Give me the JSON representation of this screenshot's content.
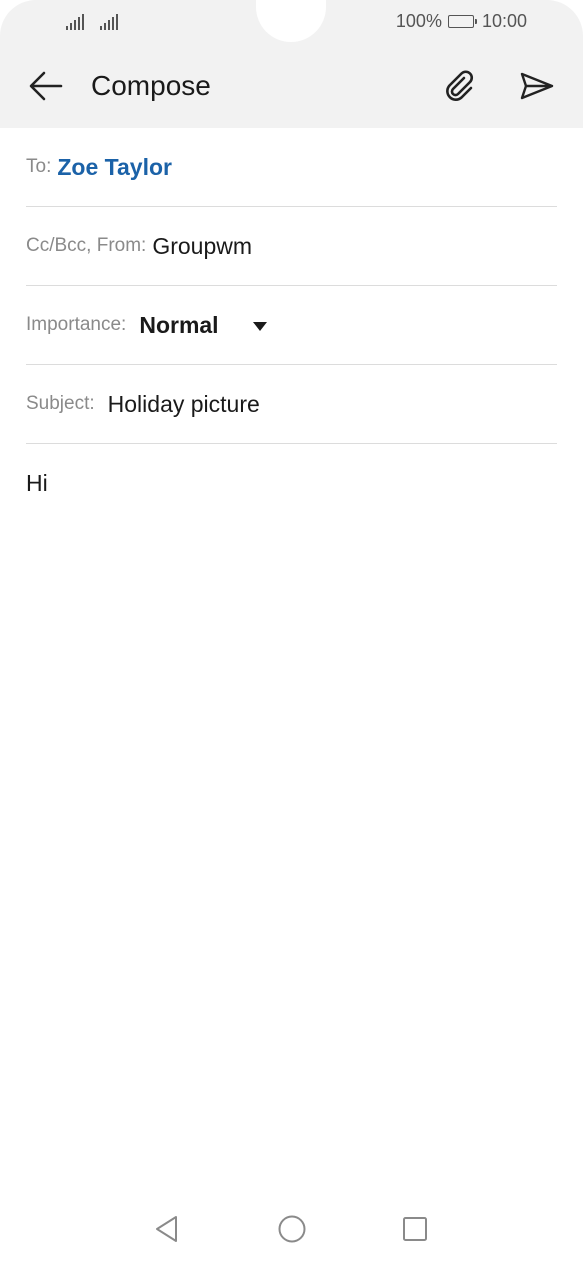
{
  "status_bar": {
    "battery_percent": "100%",
    "time": "10:00",
    "signal_icons": [
      "signal-icon",
      "signal-icon"
    ]
  },
  "app_bar": {
    "title": "Compose",
    "back_icon": "arrow-left-icon",
    "attach_icon": "paperclip-icon",
    "send_icon": "send-icon"
  },
  "fields": {
    "to": {
      "label": "To:",
      "value": "Zoe Taylor"
    },
    "cc_bcc_from": {
      "label": "Cc/Bcc, From:",
      "value": "Groupwm"
    },
    "importance": {
      "label": "Importance:",
      "value": "Normal"
    },
    "subject": {
      "label": "Subject:",
      "value": "Holiday picture"
    }
  },
  "body": {
    "text": "Hi"
  },
  "colors": {
    "recipient": "#1b62a8",
    "header_bg": "#f2f2f2"
  },
  "nav_bar": {
    "icons": [
      "triangle-back-icon",
      "circle-home-icon",
      "square-recents-icon"
    ]
  }
}
